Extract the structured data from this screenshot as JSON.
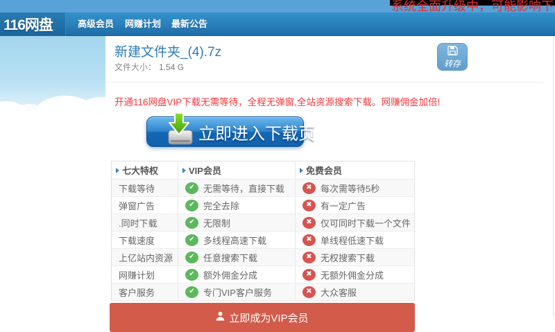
{
  "notice": {
    "text": "系统全面升级中，可能影响下"
  },
  "nav": {
    "logo": "116网盘",
    "items": [
      {
        "label": "高级会员"
      },
      {
        "label": "网赚计划"
      },
      {
        "label": "最新公告"
      }
    ]
  },
  "file": {
    "name": "新建文件夹_(4).7z",
    "size_label": "文件大小：",
    "size_value": "1.54 G"
  },
  "actions": {
    "save_label": "转存",
    "download_label": "立即进入下载页",
    "vip_label": "立即成为VIP会员"
  },
  "promo": {
    "text": "开通116网盘VIP下载无需等待，全程无弹窗,全站资源搜索下载。网赚佣金加倍!"
  },
  "comparison_table": {
    "headers": [
      {
        "label": "七大特权"
      },
      {
        "label": "VIP会员"
      },
      {
        "label": "免费会员"
      }
    ],
    "rows": [
      {
        "feature": "下载等待",
        "vip": "无需等待，直接下载",
        "free": "每次需等待5秒"
      },
      {
        "feature": "弹窗广告",
        "vip": "完全去除",
        "free": "有一定广告"
      },
      {
        "feature": ".同时下载",
        "vip": "无限制",
        "free": "仅可同时下载一个文件"
      },
      {
        "feature": "下载速度",
        "vip": "多线程高速下载",
        "free": "单线程低速下载"
      },
      {
        "feature": "上亿站内资源",
        "vip": "任意搜索下载",
        "free": "无权搜索下载"
      },
      {
        "feature": "网赚计划",
        "vip": "额外佣金分成",
        "free": "无额外佣金分成"
      },
      {
        "feature": "客户服务",
        "vip": "专门VIP客户服务",
        "free": "大众客服"
      }
    ],
    "marks": {
      "yes": "✔",
      "no": "✖"
    }
  },
  "icons": {
    "save": "floppy-disk",
    "download": "green-arrow-into-tray",
    "vip": "person-silhouette",
    "yes": "check-circle",
    "no": "cross-circle",
    "header_bullet": "right-triangle"
  },
  "colors": {
    "top_strip": "#58a2d8",
    "nav_blue": "#1d6da8",
    "alert_red": "#e03131",
    "title_blue": "#2e7cb8",
    "promo_red": "#f6383d",
    "check_green": "#5cb85c",
    "cross_red": "#d9534f",
    "vip_button_red": "#d25b4a"
  }
}
